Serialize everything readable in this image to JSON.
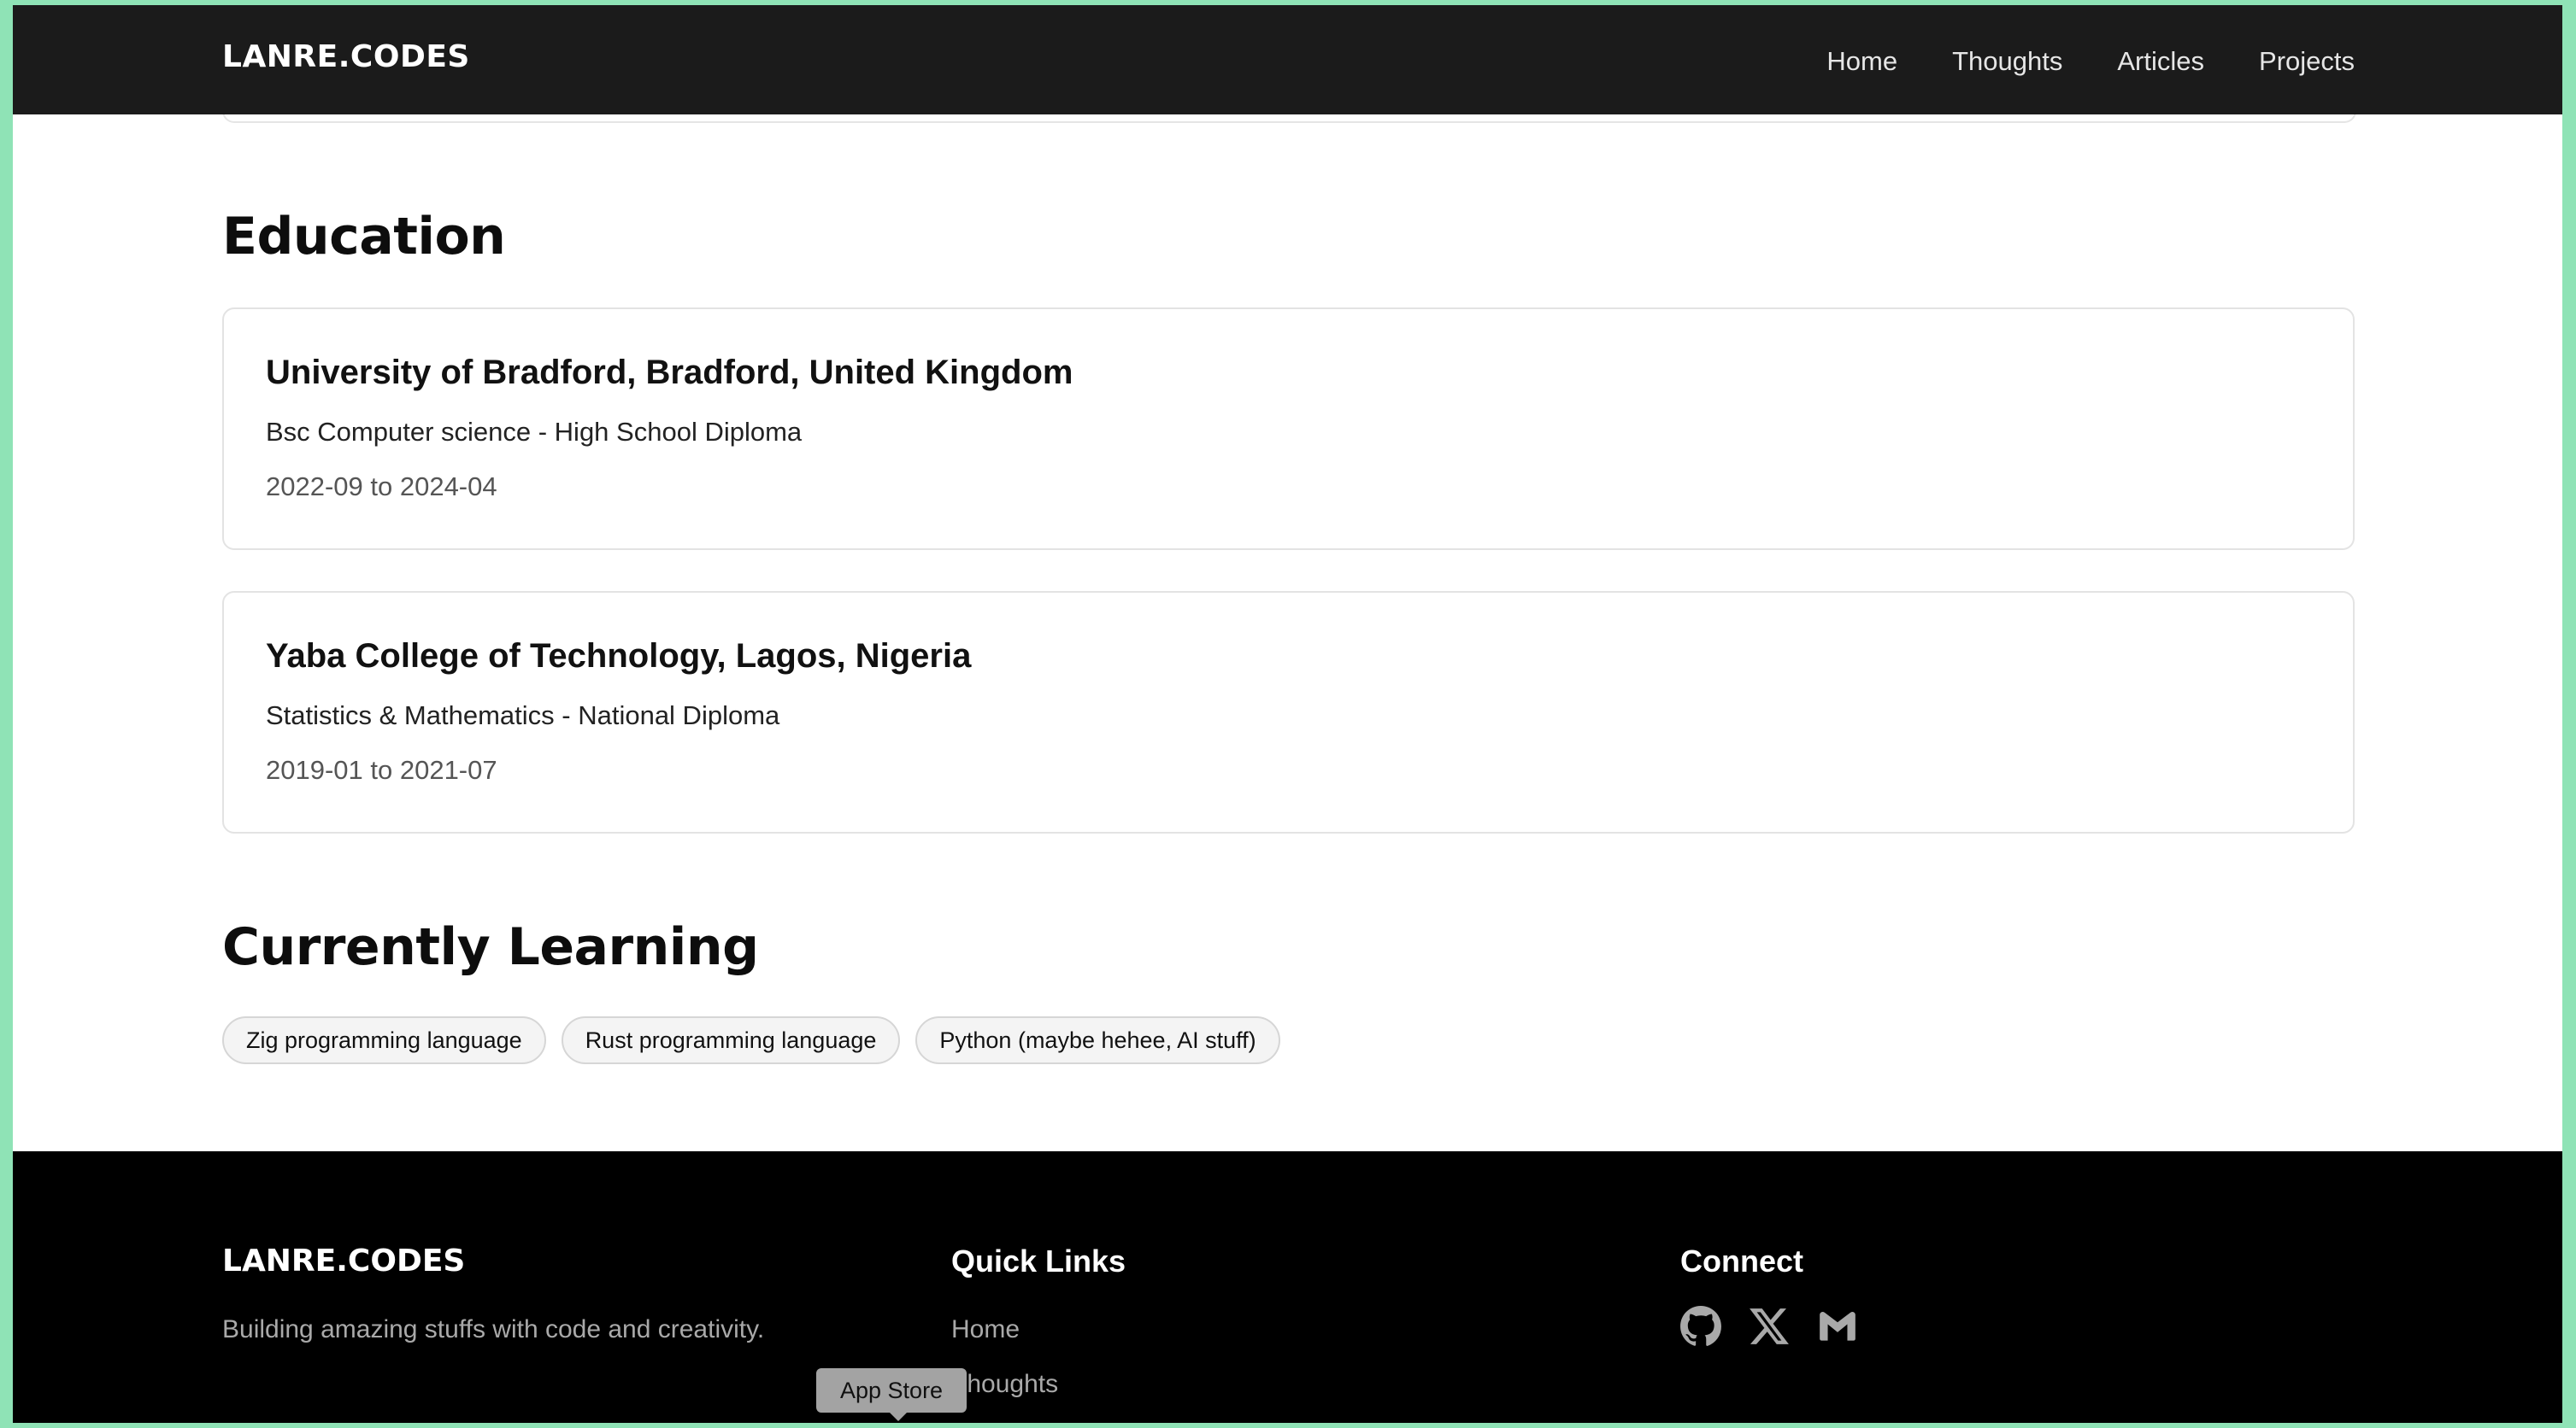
{
  "nav": {
    "brand": "LANRE.CODES",
    "links": [
      "Home",
      "Thoughts",
      "Articles",
      "Projects"
    ]
  },
  "education": {
    "title": "Education",
    "items": [
      {
        "institution": "University of Bradford, Bradford, United Kingdom",
        "degree": "Bsc Computer science - High School Diploma",
        "dates": "2022-09 to 2024-04"
      },
      {
        "institution": "Yaba College of Technology, Lagos, Nigeria",
        "degree": "Statistics & Mathematics - National Diploma",
        "dates": "2019-01 to 2021-07"
      }
    ]
  },
  "learning": {
    "title": "Currently Learning",
    "chips": [
      "Zig programming language",
      "Rust programming language",
      "Python (maybe hehee, AI stuff)"
    ]
  },
  "footer": {
    "brand": "LANRE.CODES",
    "tagline": "Building amazing stuffs with code and creativity.",
    "quick_links_title": "Quick Links",
    "quick_links": [
      "Home",
      "Thoughts"
    ],
    "connect_title": "Connect",
    "social_icons": [
      "github-icon",
      "x-icon",
      "gmail-icon"
    ]
  },
  "tooltip": "App Store",
  "colors": {
    "nav_bg": "#1b1b1b",
    "footer_bg": "#000000",
    "desktop_bg": "#8fe3b6"
  }
}
